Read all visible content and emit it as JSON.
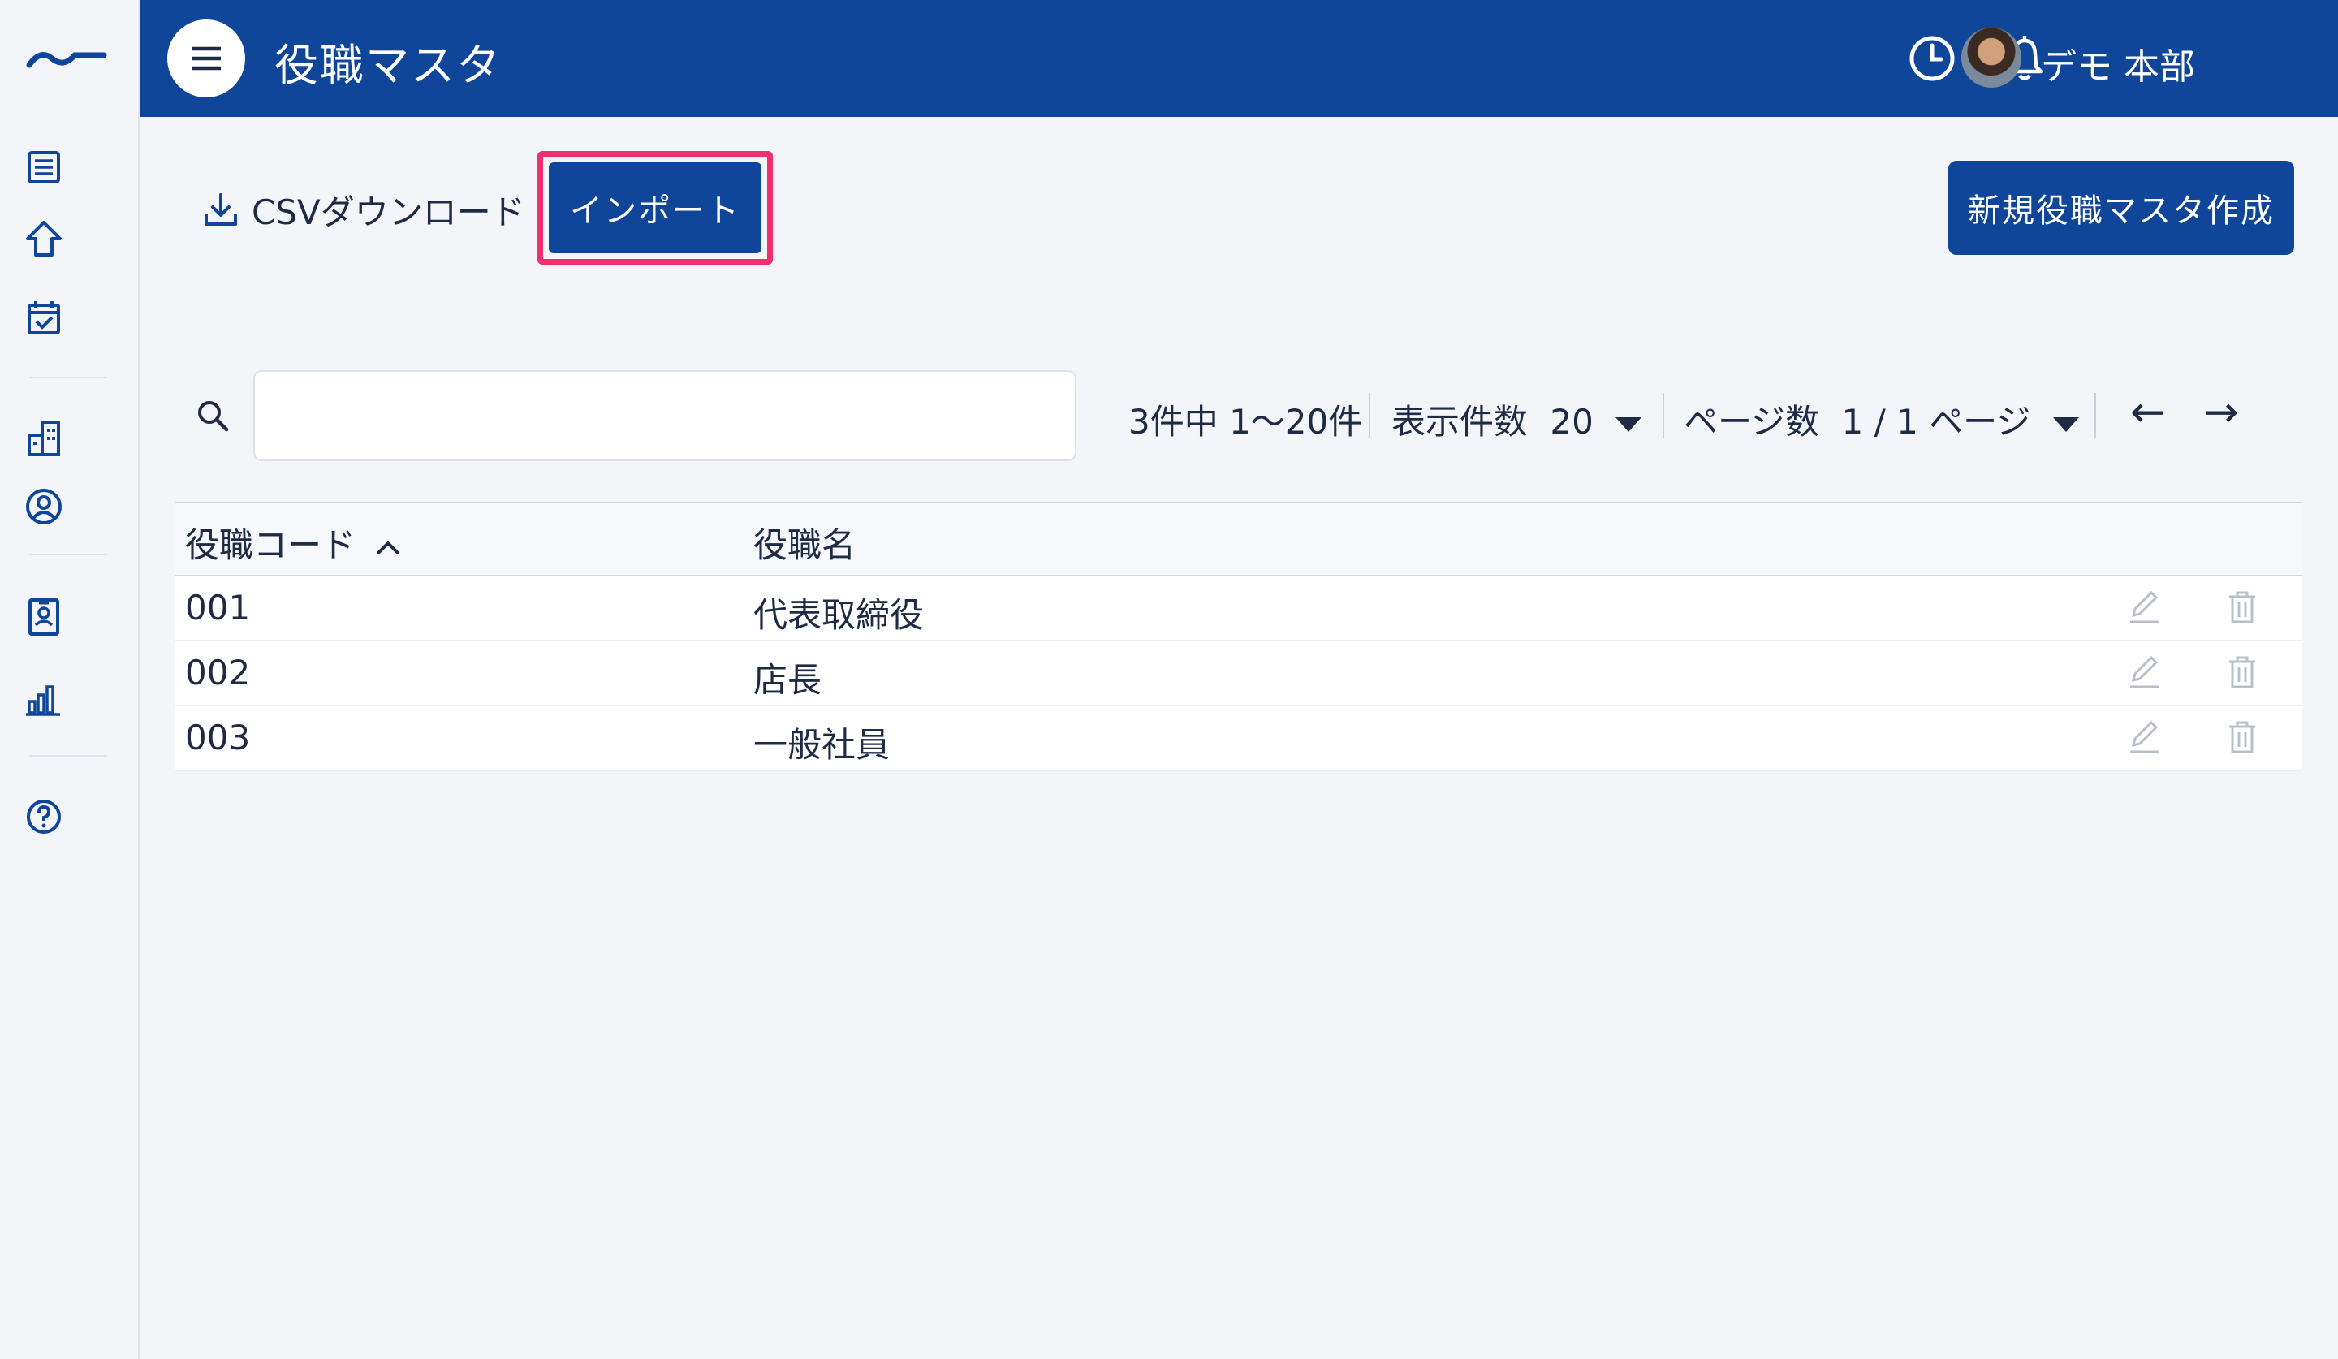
{
  "header": {
    "title": "役職マスタ",
    "user_name": "デモ 本部"
  },
  "toolbar": {
    "csv_label": "CSVダウンロード",
    "import_label": "インポート",
    "new_label": "新規役職マスタ作成"
  },
  "search": {
    "value": "",
    "placeholder": ""
  },
  "pagination": {
    "count_text": "3件中 1〜20件",
    "per_page_label": "表示件数",
    "per_page_value": "20",
    "page_label": "ページ数",
    "page_value": "1 / 1 ページ",
    "prev": "←",
    "next": "→"
  },
  "table": {
    "columns": [
      "役職コード",
      "役職名"
    ],
    "rows": [
      {
        "code": "001",
        "name": "代表取締役"
      },
      {
        "code": "002",
        "name": "店長"
      },
      {
        "code": "003",
        "name": "一般社員"
      }
    ]
  },
  "colors": {
    "brand": "#0f4699",
    "highlight": "#f0306d",
    "background": "#f3f5f8"
  },
  "icons": [
    "menu-icon",
    "clock-icon",
    "bell-icon",
    "download-icon",
    "search-icon",
    "edit-icon",
    "trash-icon",
    "sort-asc-icon",
    "list-icon",
    "home-icon",
    "calendar-check-icon",
    "building-icon",
    "user-circle-icon",
    "id-card-icon",
    "bar-chart-icon",
    "help-icon"
  ]
}
